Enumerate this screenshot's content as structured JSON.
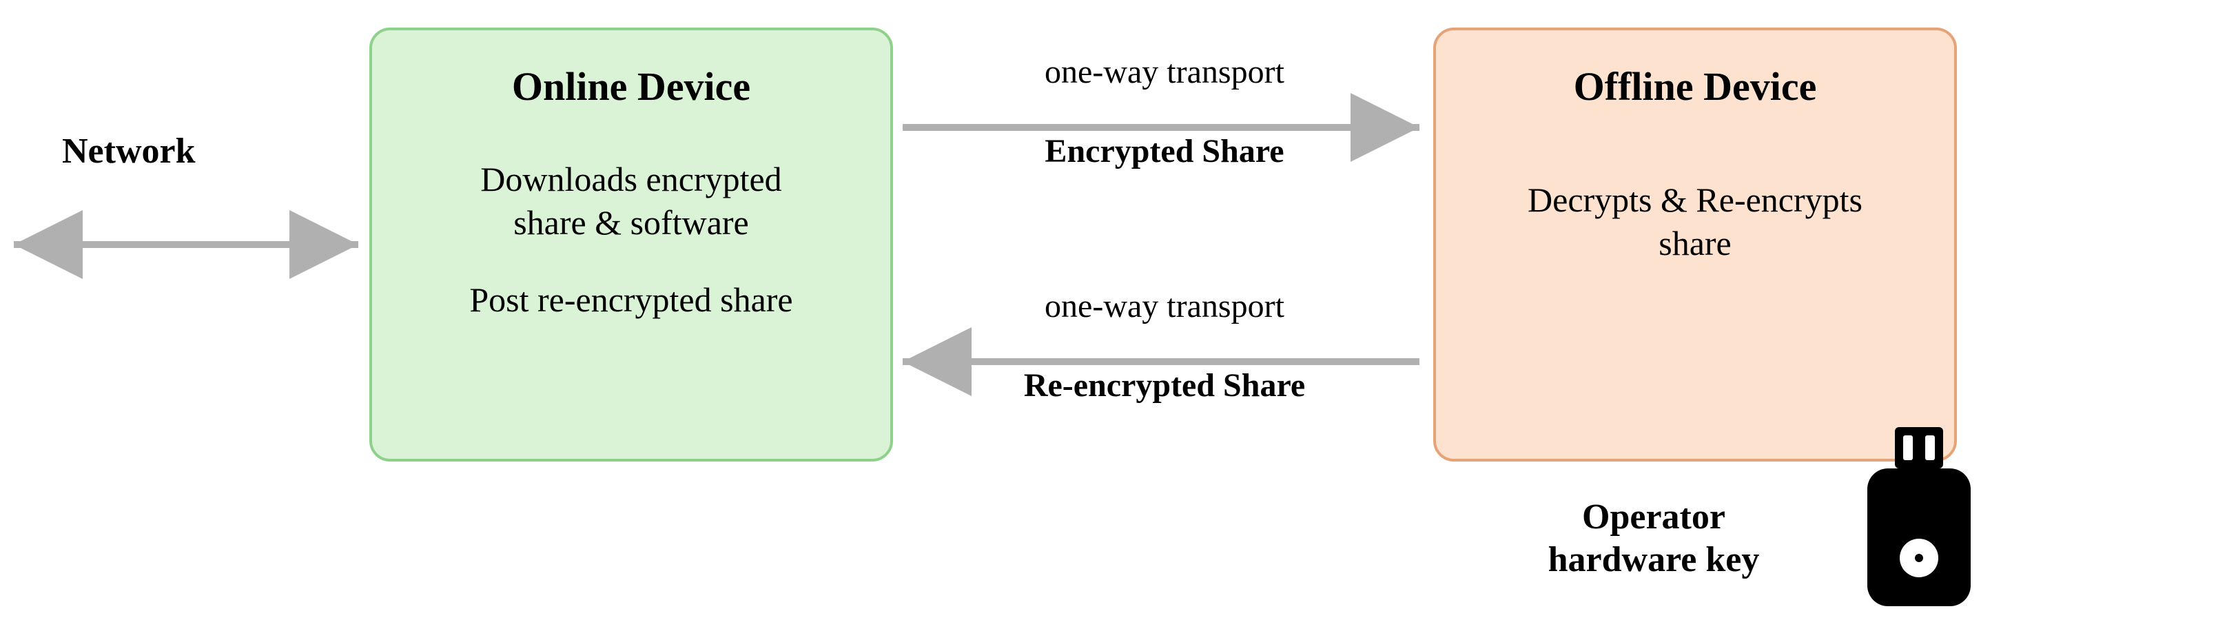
{
  "network_label": "Network",
  "online_device": {
    "title": "Online Device",
    "line1": "Downloads encrypted",
    "line2": "share & software",
    "line3": "Post re-encrypted share"
  },
  "offline_device": {
    "title": "Offline Device",
    "line1": "Decrypts & Re-encrypts",
    "line2": "share"
  },
  "arrow_top": {
    "sub": "one-way transport",
    "bold": "Encrypted Share"
  },
  "arrow_bottom": {
    "sub": "one-way transport",
    "bold": "Re-encrypted Share"
  },
  "hardware_key_label_line1": "Operator",
  "hardware_key_label_line2": "hardware key"
}
